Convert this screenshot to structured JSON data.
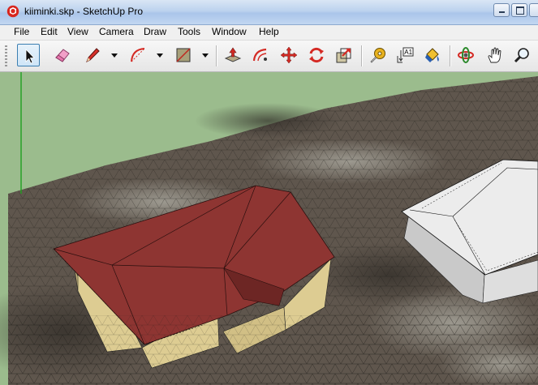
{
  "window": {
    "title": "kiiminki.skp - SketchUp Pro",
    "controls": [
      "minimize",
      "maximize",
      "close"
    ]
  },
  "menu": {
    "items": [
      "File",
      "Edit",
      "View",
      "Camera",
      "Draw",
      "Tools",
      "Window",
      "Help"
    ]
  },
  "toolbar": {
    "tools": [
      {
        "name": "select",
        "icon": "arrow-cursor-icon",
        "active": true
      },
      {
        "name": "eraser",
        "icon": "eraser-icon"
      },
      {
        "name": "line",
        "icon": "pencil-icon",
        "has_dropdown": true
      },
      {
        "name": "arc",
        "icon": "arc-icon",
        "has_dropdown": true
      },
      {
        "name": "rectangle",
        "icon": "rectangle-icon",
        "has_dropdown": true
      },
      {
        "name": "push-pull",
        "icon": "push-pull-icon"
      },
      {
        "name": "offset",
        "icon": "offset-icon"
      },
      {
        "name": "move",
        "icon": "move-icon"
      },
      {
        "name": "rotate",
        "icon": "rotate-icon"
      },
      {
        "name": "scale",
        "icon": "scale-icon"
      },
      {
        "name": "tape-measure",
        "icon": "tape-measure-icon"
      },
      {
        "name": "text",
        "icon": "text-icon",
        "label": "A1"
      },
      {
        "name": "paint-bucket",
        "icon": "paint-bucket-icon"
      },
      {
        "name": "orbit",
        "icon": "orbit-icon"
      },
      {
        "name": "pan",
        "icon": "hand-icon"
      },
      {
        "name": "zoom",
        "icon": "magnifier-icon"
      }
    ]
  },
  "colors": {
    "sky": "#9bbc8d",
    "terrain": "#5f564d",
    "roof": "#8e3532",
    "wall": "#d9c991",
    "white_building": "#ececec",
    "axis_green": "#1fa01f"
  }
}
